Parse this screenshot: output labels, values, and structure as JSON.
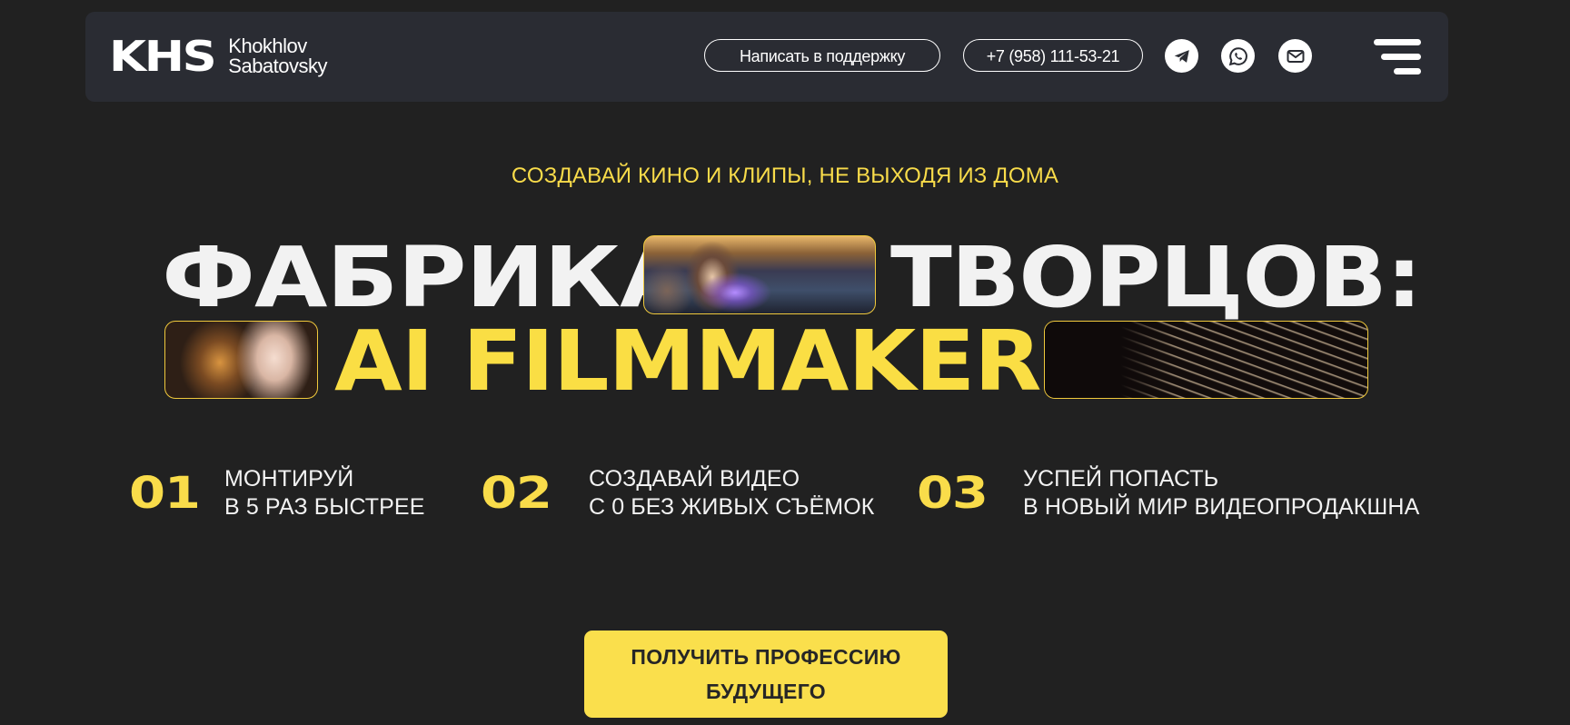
{
  "header": {
    "logo_mark": "KHS",
    "logo_line1": "Khokhlov",
    "logo_line2": "Sabatovsky",
    "support_label": "Написать в поддержку",
    "phone": "+7 (958) 111-53-21",
    "social_icons": [
      "telegram-icon",
      "whatsapp-icon",
      "mail-icon"
    ],
    "menu_icon": "hamburger-menu-icon"
  },
  "hero": {
    "tagline": "СОЗДАВАЙ КИНО И КЛИПЫ, НЕ ВЫХОДЯ ИЗ ДОМА",
    "title_word1": "ФАБРИКА",
    "title_word2": "ТВОРЦОВ:",
    "title_word3": "AI FILMMAKER",
    "accent_color": "#fade44"
  },
  "features": [
    {
      "num": "01",
      "line1": "МОНТИРУЙ",
      "line2": "В 5 РАЗ БЫСТРЕЕ"
    },
    {
      "num": "02",
      "line1": "СОЗДАВАЙ ВИДЕО",
      "line2": "С 0 БЕЗ ЖИВЫХ СЪЁМОК"
    },
    {
      "num": "03",
      "line1": "УСПЕЙ ПОПАСТЬ",
      "line2": "В НОВЫЙ МИР ВИДЕОПРОДАКШНА"
    }
  ],
  "cta": {
    "line1": "ПОЛУЧИТЬ ПРОФЕССИЮ",
    "line2": "БУДУЩЕГО"
  },
  "colors": {
    "background": "#212121",
    "header_bg": "#2a2c33",
    "yellow": "#f9dc4a"
  }
}
